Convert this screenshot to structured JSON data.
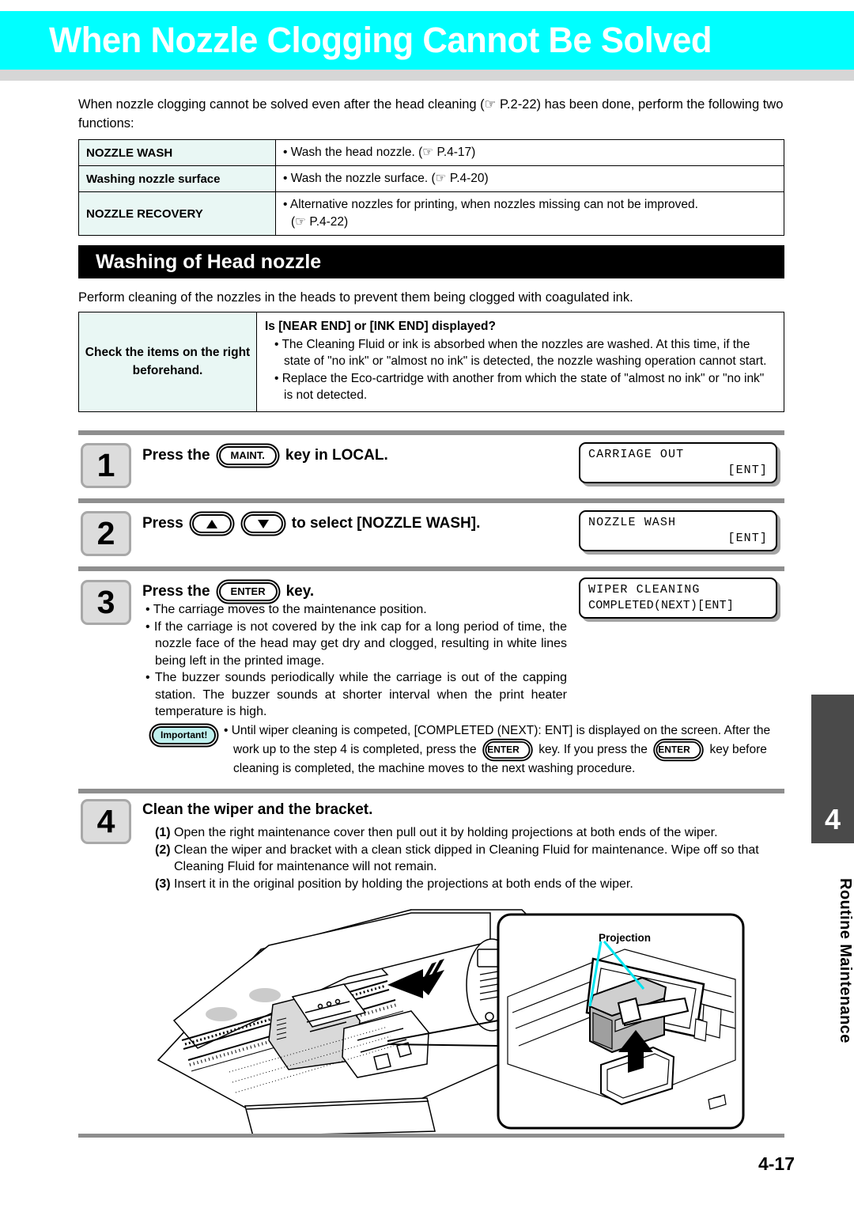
{
  "header": {
    "title": "When Nozzle Clogging Cannot Be Solved"
  },
  "intro": "When nozzle clogging cannot be solved even after the head cleaning (☞ P.2-22) has been done, perform the following two functions:",
  "functions_table": {
    "rows": [
      {
        "label": "NOZZLE WASH",
        "lines": [
          "• Wash the head nozzle. (☞ P.4-17)"
        ]
      },
      {
        "label": "Washing nozzle surface",
        "lines": [
          "•  Wash the nozzle surface. (☞ P.4-20)"
        ]
      },
      {
        "label": "NOZZLE RECOVERY",
        "lines": [
          "• Alternative nozzles for printing, when nozzles missing can not be improved.",
          "(☞ P.4-22)"
        ]
      }
    ]
  },
  "section": {
    "heading": "Washing of Head nozzle",
    "subtitle": "Perform cleaning of the nozzles in the heads to prevent them being clogged with coagulated ink."
  },
  "check_table": {
    "label": "Check the items on the right beforehand.",
    "question": "Is [NEAR END] or [INK END] displayed?",
    "bullets": [
      "• The Cleaning Fluid or ink is absorbed when the nozzles are washed. At this time, if the state of \"no ink\" or \"almost no ink\" is detected, the nozzle washing operation cannot start.",
      "• Replace the Eco-cartridge with another from which the state of \"almost no ink\" or \"no ink\" is not detected."
    ]
  },
  "steps": [
    {
      "number": "1",
      "title_before": "Press the",
      "key": "MAINT.",
      "title_after": "key in LOCAL.",
      "lcd": {
        "line1": "CARRIAGE OUT",
        "line2": "[ENT]"
      }
    },
    {
      "number": "2",
      "title_before": "Press",
      "title_after": "to select [NOZZLE WASH].",
      "key_up": "up-arrow",
      "key_down": "down-arrow",
      "lcd": {
        "line1": "NOZZLE WASH",
        "line2": "[ENT]"
      }
    },
    {
      "number": "3",
      "title_before": "Press the",
      "key": "ENTER",
      "title_after": "key.",
      "lcd": {
        "line1": "WIPER CLEANING",
        "line2": "COMPLETED(NEXT)[ENT]"
      },
      "bullets": [
        "• The carriage moves to the maintenance position.",
        "• If the carriage is not covered by the ink cap for a long period of time, the nozzle face of the head may get dry and clogged, resulting in white lines being left in the printed image.",
        "• The buzzer sounds periodically while the carriage is out of the capping station. The buzzer sounds at shorter interval when the print heater temperature is high."
      ]
    },
    {
      "number": "4",
      "title": "Clean the wiper and the bracket.",
      "substeps": [
        {
          "n": "(1)",
          "text": "Open the right maintenance cover then pull out it by holding projections at both ends of the wiper."
        },
        {
          "n": "(2)",
          "text": "Clean the wiper and bracket with a clean stick dipped in Cleaning Fluid for maintenance. Wipe off so that Cleaning Fluid for maintenance will not remain."
        },
        {
          "n": "(3)",
          "text": "Insert it in the original position by holding the projections at both ends of the wiper."
        }
      ]
    }
  ],
  "important": {
    "badge": "Important!",
    "text_part1": "• Until wiper cleaning is competed, [COMPLETED (NEXT): ENT] is displayed on the screen. After the work up to the step 4 is completed, press the",
    "key1": "ENTER",
    "text_part2": "key. If you press the",
    "key2": "ENTER",
    "text_part3": "key before cleaning is completed, the machine moves to the next washing procedure."
  },
  "illustration": {
    "callout_title": "Projection"
  },
  "side_tab": {
    "chapter_number": "4",
    "chapter_label": "Routine Maintenance"
  },
  "footer": {
    "page_number": "4-17"
  },
  "colors": {
    "banner": "#00ffff",
    "banner_text": "#ffffff",
    "under_bar": "#d6d6d6",
    "table_label_bg": "#e9f7f4",
    "section_heading_bg": "#000000",
    "rule": "#8e8e8e",
    "step_box_bg": "#dcdcdc",
    "step_box_border": "#a8a8a8",
    "side_tab_bg": "#4a4a4a",
    "important_badge_bg": "#bff0ee",
    "illustration_accent": "#00e5f0"
  }
}
